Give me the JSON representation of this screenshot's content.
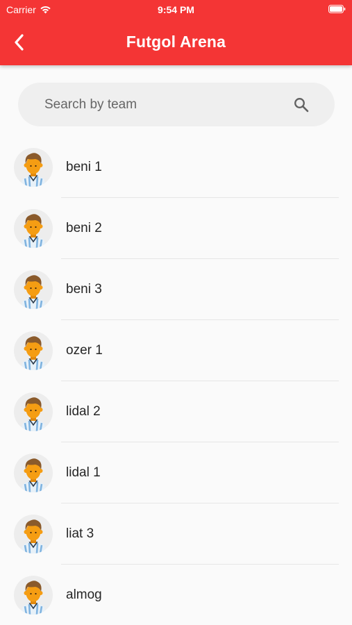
{
  "status_bar": {
    "carrier": "Carrier",
    "time": "9:54 PM"
  },
  "header": {
    "title": "Futgol Arena",
    "background_color": "#f43535"
  },
  "search": {
    "placeholder": "Search by team"
  },
  "teams": [
    {
      "name": "beni 1"
    },
    {
      "name": "beni 2"
    },
    {
      "name": "beni 3"
    },
    {
      "name": "ozer 1"
    },
    {
      "name": "lidal 2"
    },
    {
      "name": "lidal 1"
    },
    {
      "name": "liat 3"
    },
    {
      "name": "almog"
    }
  ],
  "icons": {
    "back": "chevron-left-icon",
    "search": "search-icon",
    "avatar": "player-avatar-icon",
    "wifi": "wifi-icon",
    "battery": "battery-icon"
  }
}
